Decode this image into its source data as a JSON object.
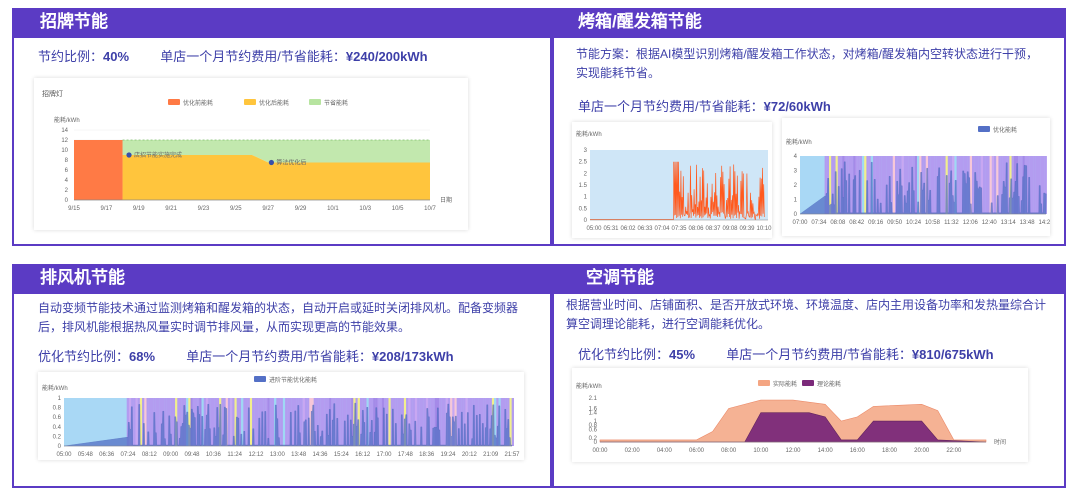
{
  "sections": {
    "signboard": {
      "title": "招牌节能",
      "ratio_label": "节约比例：",
      "ratio_value": "40%",
      "saving_label": "单店一个月节约费用/节省能耗：",
      "saving_value": "¥240/200kWh"
    },
    "oven": {
      "title": "烤箱/醒发箱节能",
      "desc": "节能方案：根据AI模型识别烤箱/醒发箱工作状态，对烤箱/醒发箱内空转状态进行干预，实现能耗节省。",
      "saving_label": "单店一个月节约费用/节省能耗：",
      "saving_value": "¥72/60kWh"
    },
    "exhaust": {
      "title": "排风机节能",
      "desc": "自动变频节能技术通过监测烤箱和醒发箱的状态，自动开启或延时关闭排风机。配备变频器后，排风机能根据热风量实时调节排风量，从而实现更高的节能效果。",
      "ratio_label": "优化节约比例：",
      "ratio_value": "68%",
      "saving_label": "单店一个月节约费用/节省能耗：",
      "saving_value": "¥208/173kWh"
    },
    "ac": {
      "title": "空调节能",
      "desc": "根据营业时间、店铺面积、是否开放式环境、环境温度、店内主用设备功率和发热量综合计算空调理论能耗，进行空调能耗优化。",
      "ratio_label": "优化节约比例：",
      "ratio_value": "45%",
      "saving_label": "单店一个月节约费用/节省能耗：",
      "saving_value": "¥810/675kWh"
    }
  },
  "chart_data": [
    {
      "type": "area",
      "title": "招牌灯",
      "ylabel": "能耗/kWh",
      "xlabel": "日期",
      "ylim": [
        0,
        14
      ],
      "yticks": [
        0,
        2,
        4,
        6,
        8,
        10,
        12,
        14
      ],
      "x_ticks": [
        "9/15",
        "9/17",
        "9/19",
        "9/21",
        "9/23",
        "9/25",
        "9/27",
        "9/29",
        "10/1",
        "10/3",
        "10/5",
        "10/7"
      ],
      "legend": [
        "优化前能耗",
        "优化后能耗",
        "节省能耗"
      ],
      "colors": {
        "before": "#ff7a45",
        "after": "#ffc53d",
        "saved": "#b7e4a0"
      },
      "series": [
        {
          "name": "优化前能耗",
          "x": [
            "9/15",
            "9/18"
          ],
          "values": [
            12,
            12
          ]
        },
        {
          "name": "优化后能耗",
          "x": [
            "9/18",
            "9/26",
            "9/27",
            "10/7"
          ],
          "values": [
            9,
            9,
            7.5,
            7.5
          ]
        },
        {
          "name": "节省能耗",
          "x": [
            "9/18",
            "10/7"
          ],
          "values": [
            12,
            12
          ]
        }
      ],
      "annotations": [
        {
          "text": "店招节能实施完成",
          "x": "9/18",
          "y": 9
        },
        {
          "text": "算法优化后",
          "x": "9/27",
          "y": 7.5
        }
      ]
    },
    {
      "type": "line",
      "ylabel": "能耗/kWh",
      "ylim": [
        0,
        3
      ],
      "yticks": [
        0,
        0.5,
        1,
        1.5,
        2,
        2.5,
        3
      ],
      "x_ticks": [
        "05:00",
        "05:31",
        "06:02",
        "06:33",
        "07:04",
        "07:35",
        "08:06",
        "08:37",
        "09:08",
        "09:39",
        "10:10"
      ],
      "series": [
        {
          "name": "",
          "color": "#ff5a1f",
          "description_range": [
            0,
            2.6
          ]
        }
      ]
    },
    {
      "type": "bar",
      "ylabel": "能耗/kWh",
      "ylim": [
        0,
        4
      ],
      "yticks": [
        0,
        1,
        2,
        3,
        4
      ],
      "x_ticks": [
        "07:00",
        "07:34",
        "08:08",
        "08:42",
        "09:16",
        "09:50",
        "10:24",
        "10:58",
        "11:32",
        "12:06",
        "12:40",
        "13:14",
        "13:48",
        "14:22"
      ],
      "legend": [
        "优化能耗"
      ],
      "series": [
        {
          "name": "优化能耗",
          "color": "#5470c6"
        }
      ]
    },
    {
      "type": "bar",
      "ylabel": "能耗/kWh",
      "ylim": [
        0,
        1
      ],
      "yticks": [
        0,
        0.2,
        0.4,
        0.6,
        0.8,
        1
      ],
      "x_ticks": [
        "05:00",
        "05:48",
        "06:36",
        "07:24",
        "08:12",
        "09:00",
        "09:48",
        "10:36",
        "11:24",
        "12:12",
        "13:00",
        "13:48",
        "14:36",
        "15:24",
        "16:12",
        "17:00",
        "17:48",
        "18:36",
        "19:24",
        "20:12",
        "21:09",
        "21:57"
      ],
      "legend": [
        "进阶节能优化能耗"
      ],
      "series": [
        {
          "name": "进阶节能优化能耗",
          "color": "#5470c6"
        }
      ]
    },
    {
      "type": "area",
      "ylabel": "能耗/kWh",
      "xlabel": "时间",
      "ylim": [
        0,
        2.1
      ],
      "yticks": [
        0,
        0.2,
        0.6,
        0.8,
        1.0,
        1.4,
        1.6,
        2.1
      ],
      "x_ticks": [
        "00:00",
        "02:00",
        "04:00",
        "06:00",
        "08:00",
        "10:00",
        "12:00",
        "14:00",
        "16:00",
        "18:00",
        "20:00",
        "22:00"
      ],
      "legend": [
        "实际能耗",
        "理论能耗"
      ],
      "series": [
        {
          "name": "实际能耗",
          "color": "#f4a582",
          "x": [
            0,
            6,
            7,
            8,
            10,
            12,
            14,
            15,
            16,
            17,
            20,
            21,
            22,
            24
          ],
          "values": [
            0.1,
            0.1,
            0.5,
            1.6,
            2.0,
            2.0,
            1.8,
            1.0,
            1.2,
            1.7,
            1.8,
            1.5,
            0.1,
            0.1
          ]
        },
        {
          "name": "理论能耗",
          "color": "#7b2a7a",
          "x": [
            0,
            9,
            10,
            13,
            14,
            15,
            16,
            17,
            20,
            21,
            24
          ],
          "values": [
            0,
            0,
            1.4,
            1.4,
            1.2,
            0.1,
            0.1,
            1.0,
            1.0,
            0.1,
            0
          ]
        }
      ]
    }
  ]
}
